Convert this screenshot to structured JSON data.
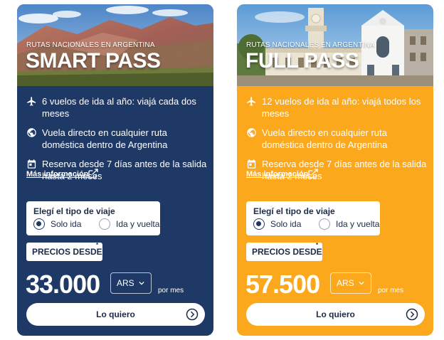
{
  "cards": [
    {
      "subtitle": "RUTAS NACIONALES EN ARGENTINA",
      "title": "SMART PASS",
      "features": [
        "6 vuelos de ida al año: viajá cada dos meses",
        "Vuela directo en cualquier ruta doméstica dentro de Argentina",
        "Reserva desde 7 días antes de la salida hasta 2 meses"
      ],
      "more_info": "Más información",
      "trip_type_title": "Elegí el tipo de viaje",
      "trip_options": [
        "Solo ida",
        "Ida y vuelta"
      ],
      "selected_option": "Solo ida",
      "price_badge": "PRECIOS DESDE",
      "price_badge_mark": "*",
      "price": "33.000",
      "currency": "ARS",
      "period": "por mes",
      "cta": "Lo quiero",
      "background_color": "#1f3967"
    },
    {
      "subtitle": "RUTAS NACIONALES EN ARGENTINA",
      "title": "FULL PASS",
      "features": [
        "12 vuelos de ida al año: viajá todos los meses",
        "Vuela directo en cualquier ruta doméstica dentro de Argentina",
        "Reserva desde 7 días antes de la salida hasta 2 meses"
      ],
      "more_info": "Más información",
      "trip_type_title": "Elegí el tipo de viaje",
      "trip_options": [
        "Solo ida",
        "Ida y vuelta"
      ],
      "selected_option": "Solo ida",
      "price_badge": "PRECIOS DESDE",
      "price_badge_mark": "*",
      "price": "57.500",
      "currency": "ARS",
      "period": "por mes",
      "cta": "Lo quiero",
      "background_color": "#fca81c"
    }
  ],
  "icons": {
    "feature_icons": [
      "airplane-icon",
      "globe-icon",
      "calendar-icon"
    ],
    "more_info_icon": "external-link-icon",
    "currency_icon": "chevron-down-icon",
    "cta_icon": "arrow-right-circle-icon"
  }
}
